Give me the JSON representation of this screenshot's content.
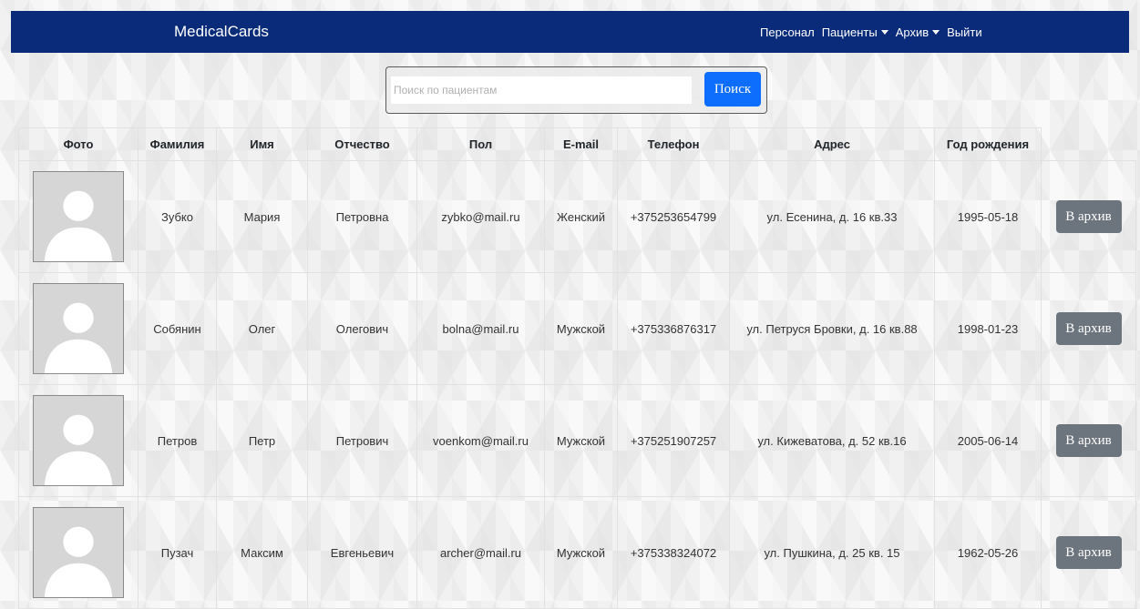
{
  "navbar": {
    "brand": "MedicalCards",
    "links": [
      {
        "label": "Персонал",
        "dropdown": false
      },
      {
        "label": "Пациенты",
        "dropdown": true
      },
      {
        "label": "Архив",
        "dropdown": true
      },
      {
        "label": "Выйти",
        "dropdown": false
      }
    ],
    "background": "#0a2b7a"
  },
  "search": {
    "placeholder": "Поиск по пациентам",
    "value": "",
    "button_label": "Поиск",
    "button_color": "#0d6efd"
  },
  "table": {
    "headers": [
      "Фото",
      "Фамилия",
      "Имя",
      "Отчество",
      "Пол",
      "E-mail",
      "Телефон",
      "Адрес",
      "Год рождения",
      ""
    ],
    "rows": [
      {
        "surname": "Зубко",
        "name": "Мария",
        "patronymic": "Петровна",
        "email": "zybko@mail.ru",
        "gender": "Женский",
        "phone": "+375253654799",
        "address": "ул. Есенина, д. 16 кв.33",
        "birth": "1995-05-18",
        "action": "В архив"
      },
      {
        "surname": "Собянин",
        "name": "Олег",
        "patronymic": "Олегович",
        "email": "bolna@mail.ru",
        "gender": "Мужской",
        "phone": "+375336876317",
        "address": "ул. Петруся Бровки, д. 16 кв.88",
        "birth": "1998-01-23",
        "action": "В архив"
      },
      {
        "surname": "Петров",
        "name": "Петр",
        "patronymic": "Петрович",
        "email": "voenkom@mail.ru",
        "gender": "Мужской",
        "phone": "+375251907257",
        "address": "ул. Кижеватова, д. 52 кв.16",
        "birth": "2005-06-14",
        "action": "В архив"
      },
      {
        "surname": "Пузач",
        "name": "Максим",
        "patronymic": "Евгеньевич",
        "email": "archer@mail.ru",
        "gender": "Мужской",
        "phone": "+375338324072",
        "address": "ул. Пушкина, д. 25 кв. 15",
        "birth": "1962-05-26",
        "action": "В архив"
      }
    ],
    "archive_button_color": "#6c757d"
  }
}
